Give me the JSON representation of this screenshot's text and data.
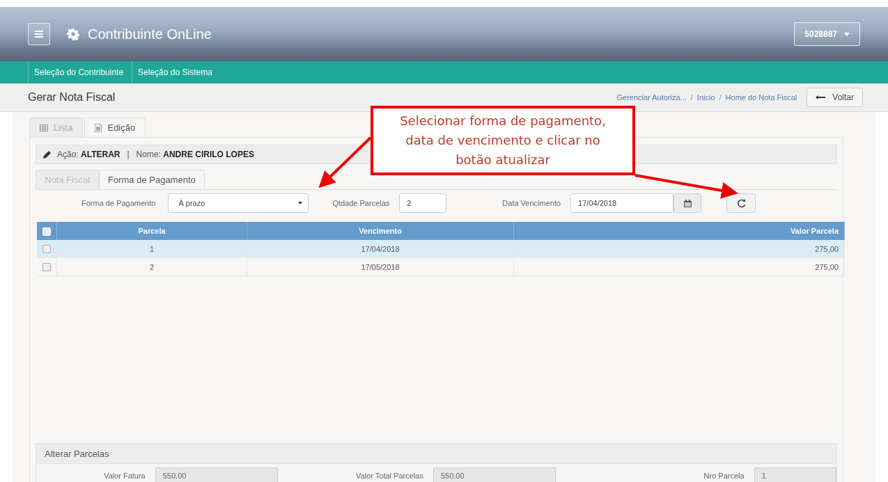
{
  "header": {
    "title": "Contribuinte OnLine",
    "user_button": "5028887"
  },
  "nav": [
    {
      "label": "Seleção do Contribuinte"
    },
    {
      "label": "Seleção do Sistema"
    }
  ],
  "page": {
    "title": "Gerar Nota Fiscal",
    "breadcrumbs": [
      "Gerenciar Autoriza...",
      "Inicio",
      "Home do Nota Fiscal"
    ],
    "breadcrumb_separators": [
      "/",
      "/"
    ],
    "back_button": "Voltar"
  },
  "tabs": [
    {
      "label": "Lista",
      "selected": false
    },
    {
      "label": "Edição",
      "selected": true
    }
  ],
  "action_bar": {
    "action_label": "Ação:",
    "action_value": "ALTERAR",
    "separator": "|",
    "name_label": "Nome:",
    "name_value": "ANDRE CIRILO LOPES"
  },
  "subtabs": [
    {
      "label": "Nota Fiscal",
      "selected": false
    },
    {
      "label": "Forma de Pagamento",
      "selected": true
    }
  ],
  "form": {
    "payment_label": "Forma de Pagamento",
    "payment_value": "À prazo",
    "installments_label": "Qtdade Parcelas",
    "installments_value": "2",
    "due_label": "Data Vencimento",
    "due_value": "17/04/2018"
  },
  "table": {
    "columns": [
      "Parcela",
      "Vencimento",
      "Valor Parcela"
    ],
    "header_checked": false,
    "rows": [
      {
        "cells": [
          "1",
          "17/04/2018",
          "275,00"
        ],
        "checked": false,
        "selected": true
      },
      {
        "cells": [
          "2",
          "17/05/2018",
          "275,00"
        ],
        "checked": false,
        "selected": false
      }
    ]
  },
  "alter_panel": {
    "title": "Alterar Parcelas",
    "fields": [
      {
        "label": "Valor Fatura",
        "value": "550.00"
      },
      {
        "label": "Valor Total Parcelas",
        "value": "550.00"
      },
      {
        "label": "Nro Parcela",
        "value": "1"
      }
    ]
  },
  "annotation": {
    "lines": [
      "Selecionar forma de pagamento,",
      "data de vencimento e clicar no",
      "botão atualizar"
    ]
  }
}
